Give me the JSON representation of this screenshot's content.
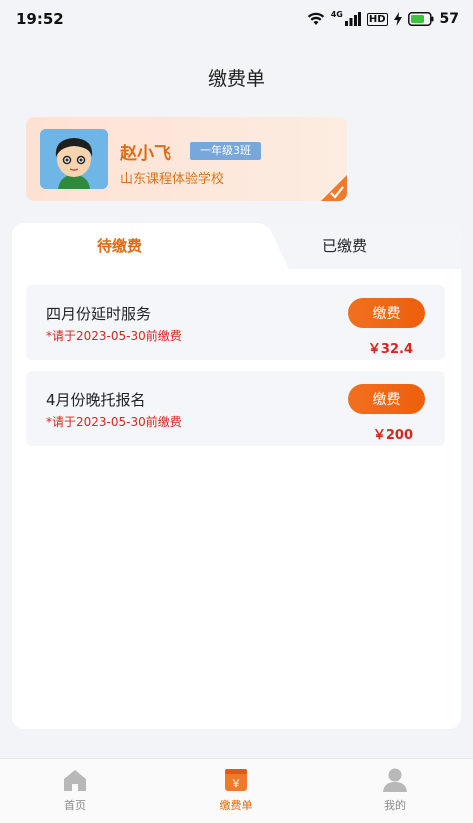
{
  "status_bar": {
    "time": "19:52",
    "battery": "57",
    "network": "4G",
    "hd": "HD"
  },
  "header": {
    "title": "缴费单"
  },
  "student": {
    "name": "赵小飞",
    "class_name": "一年级3班",
    "school": "山东课程体验学校"
  },
  "tabs": [
    {
      "label": "待缴费",
      "active": true
    },
    {
      "label": "已缴费",
      "active": false
    }
  ],
  "fee_items": [
    {
      "title": "四月份延时服务",
      "deadline": "*请于2023-05-30前缴费",
      "button_label": "缴费",
      "amount": "￥32.4"
    },
    {
      "title": "4月份晚托报名",
      "deadline": "*请于2023-05-30前缴费",
      "button_label": "缴费",
      "amount": "￥200"
    }
  ],
  "bottom_nav": [
    {
      "label": "首页",
      "icon": "home-icon",
      "active": false
    },
    {
      "label": "缴费单",
      "icon": "payment-icon",
      "active": true,
      "icon_text": "￥"
    },
    {
      "label": "我的",
      "icon": "user-icon",
      "active": false
    }
  ],
  "colors": {
    "accent": "#e06a12",
    "button": "#ee6412",
    "deadline": "#d9251e",
    "badge": "#78a7dc"
  }
}
